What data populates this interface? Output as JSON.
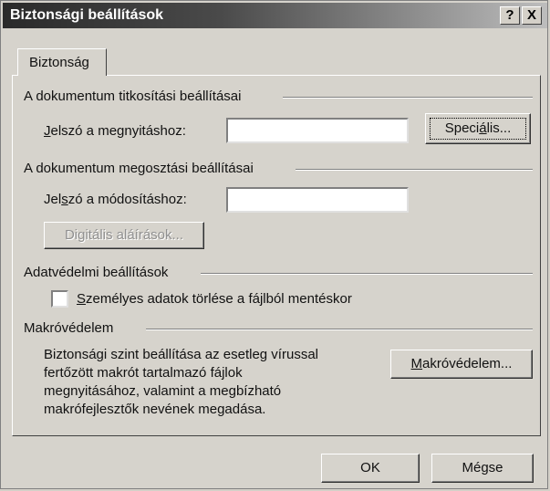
{
  "window": {
    "title": "Biztonsági beállítások",
    "help": "?",
    "close": "X"
  },
  "tab": {
    "label": "Biztonság"
  },
  "encryption": {
    "section_title": "A dokumentum titkosítási beállításai",
    "password_label_u": "J",
    "password_label_rest": "elszó a megnyitáshoz:",
    "password_value": "",
    "advanced_pre": "Speci",
    "advanced_u": "á",
    "advanced_post": "lis..."
  },
  "sharing": {
    "section_title": "A dokumentum megosztási beállításai",
    "password_label_pre": "Jel",
    "password_label_u": "s",
    "password_label_post": "zó a módosításhoz:",
    "password_value": "",
    "digital_signatures": "Digitális aláírások..."
  },
  "privacy": {
    "section_title": "Adatvédelmi beállítások",
    "remove_info_u": "S",
    "remove_info_rest": "zemélyes adatok törlése a fájlból mentéskor",
    "remove_info_checked": false
  },
  "macro": {
    "section_title": "Makróvédelem",
    "description_lines": [
      "Biztonsági szint beállítása az esetleg vírussal",
      "fertőzött makrót  tartalmazó fájlok",
      "megnyitásához, valamint a megbízható",
      "makrófejlesztők nevének megadása."
    ],
    "button_u": "M",
    "button_rest": "akróvédelem..."
  },
  "footer": {
    "ok": "OK",
    "cancel": "Mégse"
  }
}
